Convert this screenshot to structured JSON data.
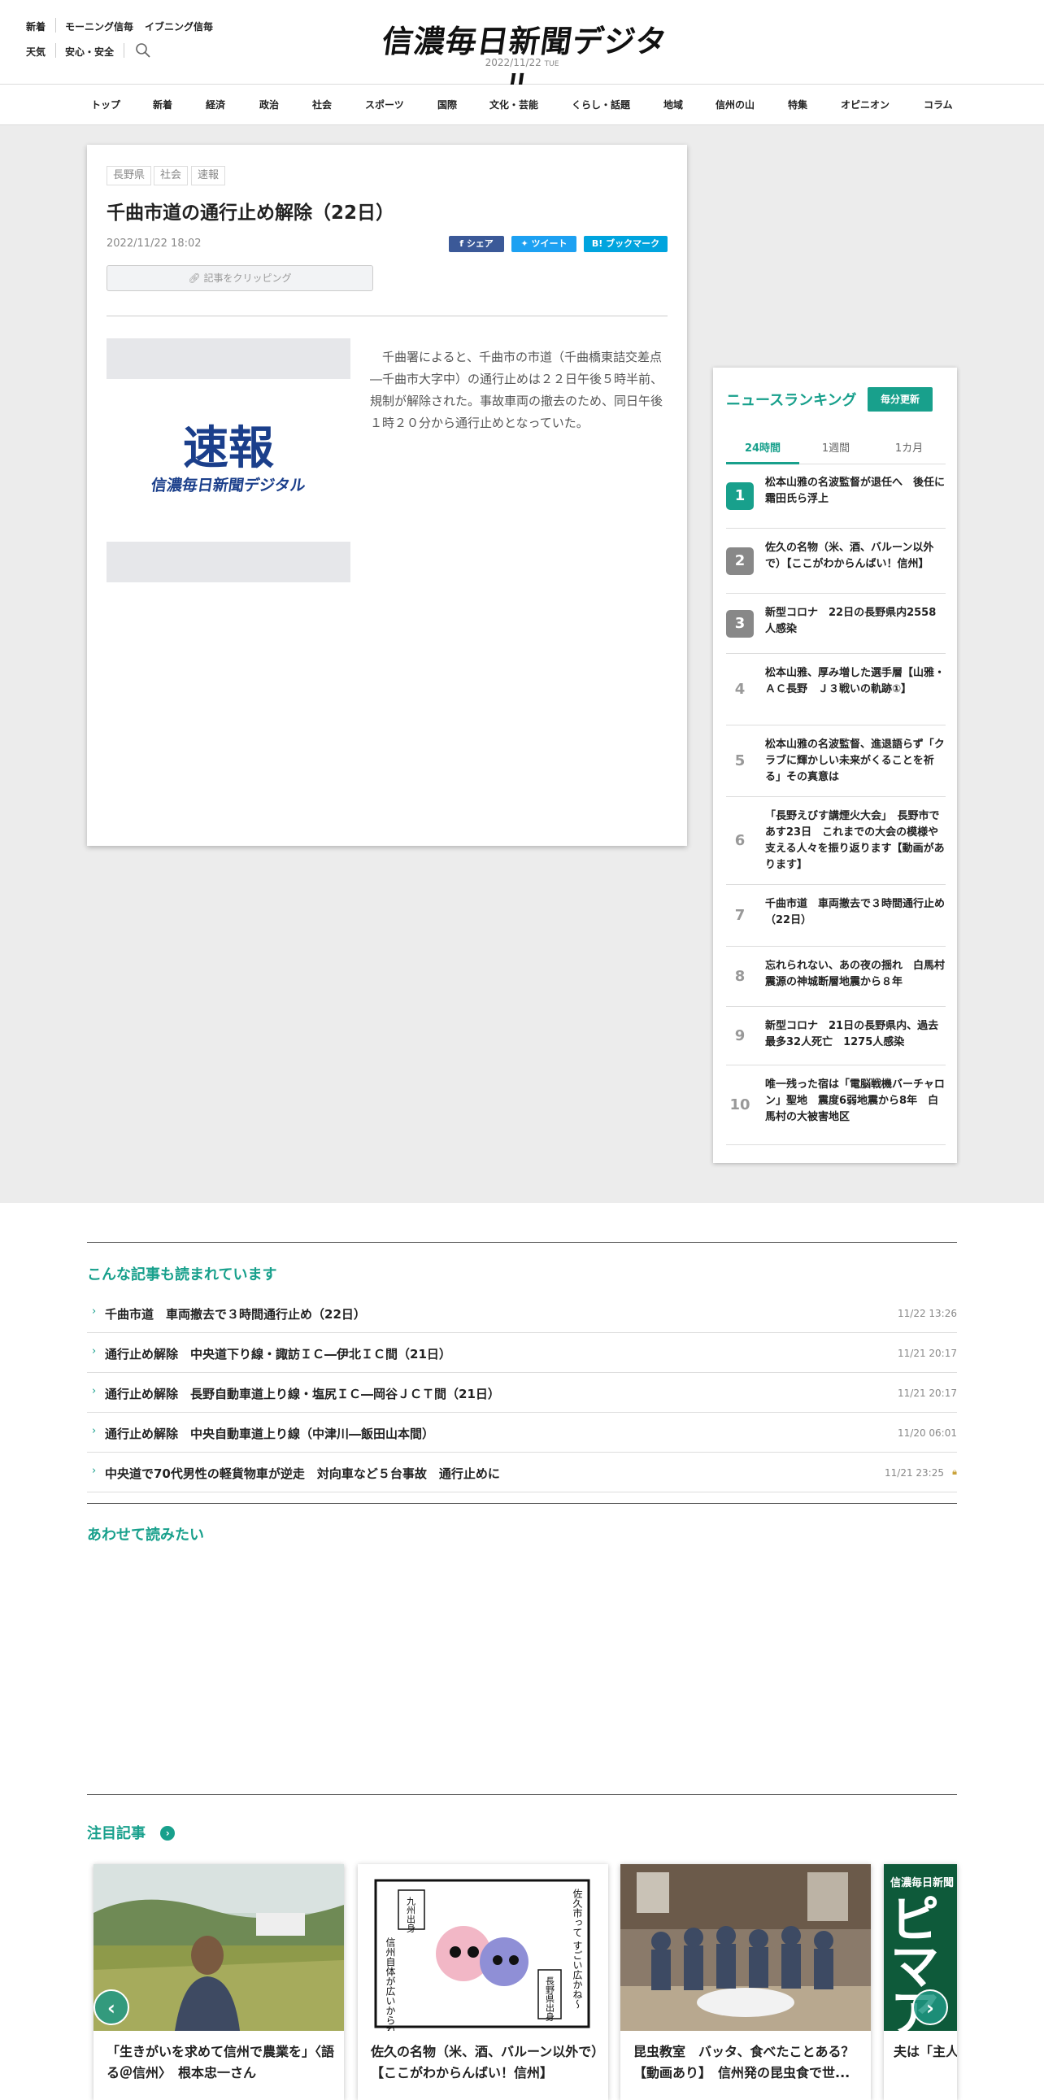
{
  "header": {
    "links_row1": [
      "新着",
      "モーニング信毎",
      "イブニング信毎"
    ],
    "links_row2": [
      "天気",
      "安心・安全"
    ],
    "logo": "信濃毎日新聞デジタル",
    "date": "2022/11/22",
    "weekday": "TUE"
  },
  "nav": [
    "トップ",
    "新着",
    "経済",
    "政治",
    "社会",
    "スポーツ",
    "国際",
    "文化・芸能",
    "くらし・話題",
    "地域",
    "信州の山",
    "特集",
    "オピニオン",
    "コラム"
  ],
  "article": {
    "tags": [
      "長野県",
      "社会",
      "速報"
    ],
    "title": "千曲市道の通行止め解除（22日）",
    "datetime": "2022/11/22 18:02",
    "share_fb": "シェア",
    "share_tw": "ツイート",
    "share_bm": "ブックマーク",
    "clip_label": "記事をクリッピング",
    "image_title": "速報",
    "image_sub": "信濃毎日新聞デジタル",
    "body": "千曲署によると、千曲市の市道（千曲橋東詰交差点―千曲市大字中）の通行止めは２２日午後５時半前、規制が解除された。事故車両の撤去のため、同日午後１時２０分から通行止めとなっていた。"
  },
  "ranking": {
    "title": "ニュースランキング",
    "update_btn": "毎分更新",
    "tabs": [
      "24時間",
      "1週間",
      "1カ月"
    ],
    "items": [
      {
        "n": "1",
        "t": "松本山雅の名波監督が退任へ　後任に霜田氏ら浮上"
      },
      {
        "n": "2",
        "t": "佐久の名物（米、酒、バルーン以外で）【ここがわからんばい！信州】"
      },
      {
        "n": "3",
        "t": "新型コロナ　22日の長野県内2558人感染"
      },
      {
        "n": "4",
        "t": "松本山雅、厚み増した選手層【山雅・ＡＣ長野　Ｊ３戦いの軌跡①】"
      },
      {
        "n": "5",
        "t": "松本山雅の名波監督、進退語らず「クラブに輝かしい未来がくることを祈る」その真意は"
      },
      {
        "n": "6",
        "t": "「長野えびす講煙火大会」　長野市であす23日　これまでの大会の模様や支える人々を振り返ります【動画があります】"
      },
      {
        "n": "7",
        "t": "千曲市道　車両撤去で３時間通行止め（22日）"
      },
      {
        "n": "8",
        "t": "忘れられない、あの夜の揺れ　白馬村震源の神城断層地震から８年"
      },
      {
        "n": "9",
        "t": "新型コロナ　21日の長野県内、過去最多32人死亡　1275人感染"
      },
      {
        "n": "10",
        "t": "唯一残った宿は「電脳戦機バーチャロン」聖地　震度6弱地震から8年　白馬村の大被害地区"
      }
    ]
  },
  "related": {
    "heading": "こんな記事も読まれています",
    "items": [
      {
        "t": "千曲市道　車両撤去で３時間通行止め（22日）",
        "d": "11/22 13:26"
      },
      {
        "t": "通行止め解除　中央道下り線・諏訪ＩＣ―伊北ＩＣ間（21日）",
        "d": "11/21 20:17"
      },
      {
        "t": "通行止め解除　長野自動車道上り線・塩尻ＩＣ―岡谷ＪＣＴ間（21日）",
        "d": "11/21 20:17"
      },
      {
        "t": "通行止め解除　中央自動車道上り線（中津川―飯田山本間）",
        "d": "11/20 06:01"
      },
      {
        "t": "中央道で70代男性の軽貨物車が逆走　対向車など５台事故　通行止めに",
        "d": "11/21 23:25"
      }
    ]
  },
  "also_read": {
    "heading": "あわせて読みたい"
  },
  "featured": {
    "heading": "注目記事",
    "cards": [
      {
        "caption": "「生きがいを求めて信州で農業を」〈語る＠信州〉　根本忠一さん"
      },
      {
        "caption": "佐久の名物（米、酒、バルーン以外で）【ここがわからんばい！信州】"
      },
      {
        "caption": "昆虫教室　バッタ、食べたことある？【動画あり】　信州発の昆虫食で世..."
      },
      {
        "caption": "夫は「主人」い、女性の..."
      }
    ],
    "manga_texts": [
      "九州出身",
      "佐久市って すごい広かね〜",
      "信州自体が広いからね",
      "長野県出身"
    ],
    "card4_banner": "信濃毎日新聞",
    "card4_big": "ピマア"
  },
  "colors": {
    "accent": "#18a08c",
    "rank_top": "#18a08c",
    "rank_gray": "#888888"
  }
}
